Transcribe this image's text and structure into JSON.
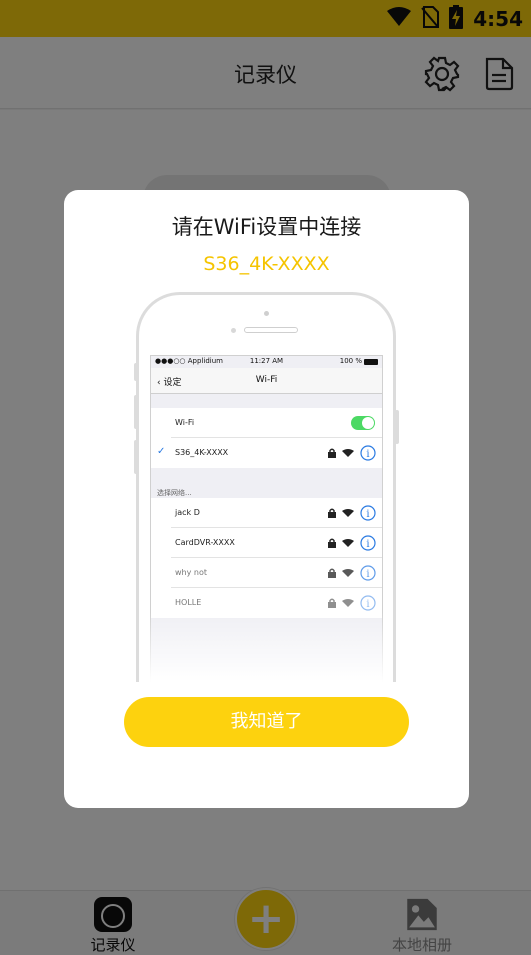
{
  "status_bar": {
    "time": "4:54",
    "icons": [
      "wifi-icon",
      "no-sim-icon",
      "battery-charging-icon"
    ]
  },
  "app_bar": {
    "title": "记录仪",
    "icons": [
      "gear-icon",
      "document-icon"
    ]
  },
  "bottom_nav": {
    "record_label": "记录仪",
    "album_label": "本地相册",
    "fab_icon": "plus-icon"
  },
  "dialog": {
    "title": "请在WiFi设置中连接",
    "ssid": "S36_4K-XXXX",
    "confirm_label": "我知道了",
    "phone": {
      "status_left": "●●●○○ Applidium",
      "status_time": "11:27 AM",
      "status_battery": "100 %",
      "back_label": "设定",
      "nav_title": "Wi-Fi",
      "wifi_row_label": "Wi-Fi",
      "connected_network": "S36_4K-XXXX",
      "section_label": "选择网络...",
      "networks": [
        "jack D",
        "CardDVR-XXXX",
        "why not",
        "HOLLE"
      ]
    }
  },
  "colors": {
    "accent": "#fdd20e",
    "ssid_text": "#f5c400",
    "ios_toggle": "#4cd964",
    "ios_blue": "#2a7ae2"
  }
}
